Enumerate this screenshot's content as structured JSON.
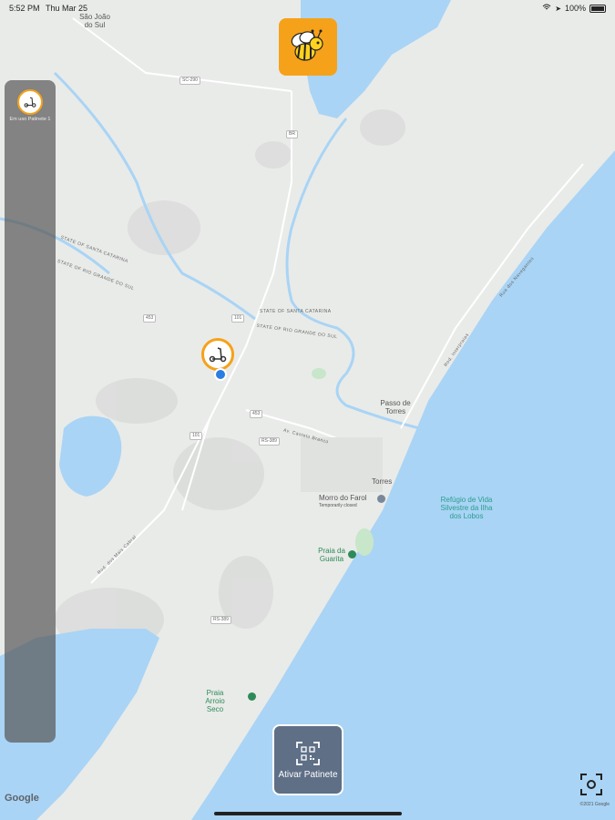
{
  "status_bar": {
    "time": "5:52 PM",
    "date": "Thu Mar 25",
    "battery": "100%"
  },
  "side_panel": {
    "items": [
      {
        "label": "Em uso Patinete 1",
        "icon": "scooter-icon"
      }
    ]
  },
  "activate_button": {
    "label": "Ativar Patinete",
    "icon": "qr-scan-icon"
  },
  "map": {
    "labels": [
      {
        "text": "São João do Sul"
      },
      {
        "text": "STATE OF SANTA CATARINA"
      },
      {
        "text": "STATE OF RIO GRANDE DO SUL"
      },
      {
        "text": "STATE OF SANTA CATARINA"
      },
      {
        "text": "STATE OF RIO GRANDE DO SUL"
      },
      {
        "text": "Passo de Torres"
      },
      {
        "text": "Torres"
      },
      {
        "text": "Morro do Farol"
      },
      {
        "text": "Temporarily closed"
      },
      {
        "text": "Refúgio de Vida Silvestre da Ilha dos Lobos"
      },
      {
        "text": "Praia da Guarita"
      },
      {
        "text": "Praia Arroio Seco"
      },
      {
        "text": "Rod. Interpraias"
      },
      {
        "text": "Rua dos Navegantes"
      },
      {
        "text": "Av. Castelo Branco"
      },
      {
        "text": "Rod. dos Mais Cabral"
      }
    ],
    "shields": [
      "SC-290",
      "BR",
      "453",
      "101",
      "453",
      "101",
      "RS-389",
      "RS-389"
    ],
    "google_logo": "Google",
    "copyright": "©2021 Google",
    "colors": {
      "water": "#a9d4f5",
      "land": "#e9ebe9",
      "accent": "#f5a21a",
      "button": "#5e6f86"
    }
  }
}
